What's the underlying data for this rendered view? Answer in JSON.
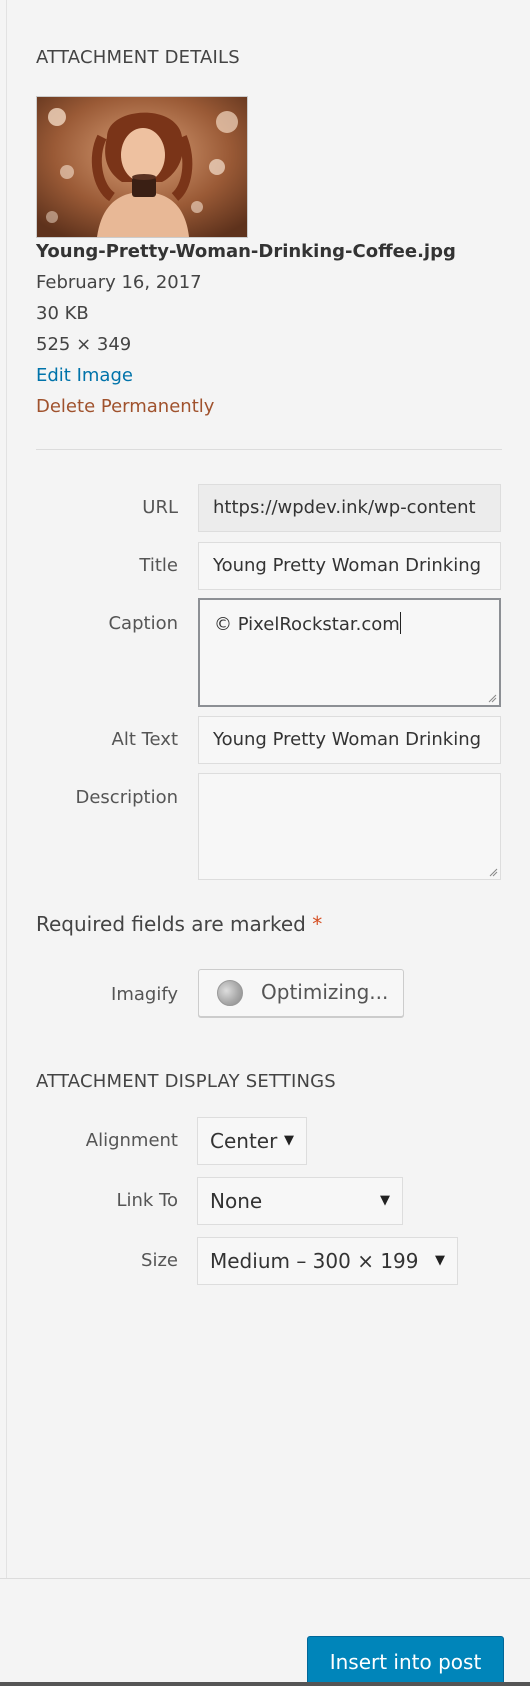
{
  "attachment_details": {
    "title": "ATTACHMENT DETAILS",
    "filename": "Young-Pretty-Woman-Drinking-Coffee.jpg",
    "date": "February 16, 2017",
    "filesize": "30 KB",
    "dimensions": "525 × 349",
    "edit_image": "Edit Image",
    "delete_permanently": "Delete Permanently"
  },
  "fields": {
    "url": {
      "label": "URL",
      "value": "https://wpdev.ink/wp-content"
    },
    "title": {
      "label": "Title",
      "value": "Young Pretty Woman Drinking"
    },
    "caption": {
      "label": "Caption",
      "value": "© PixelRockstar.com"
    },
    "alt_text": {
      "label": "Alt Text",
      "value": "Young Pretty Woman Drinking"
    },
    "description": {
      "label": "Description",
      "value": ""
    }
  },
  "required_note": {
    "text": "Required fields are marked",
    "star": "*"
  },
  "imagify": {
    "label": "Imagify",
    "button_label": "Optimizing..."
  },
  "display_settings": {
    "title": "ATTACHMENT DISPLAY SETTINGS",
    "alignment": {
      "label": "Alignment",
      "value": "Center"
    },
    "link_to": {
      "label": "Link To",
      "value": "None"
    },
    "size": {
      "label": "Size",
      "value": "Medium – 300 × 199"
    }
  },
  "footer": {
    "insert_button": "Insert into post"
  },
  "colors": {
    "accent": "#0085ba",
    "link": "#0073aa",
    "delete": "#a0522d",
    "required_star": "#d54e21"
  },
  "icons": {
    "dropdown": "triangle-down-icon",
    "spinner": "spinner-icon"
  }
}
